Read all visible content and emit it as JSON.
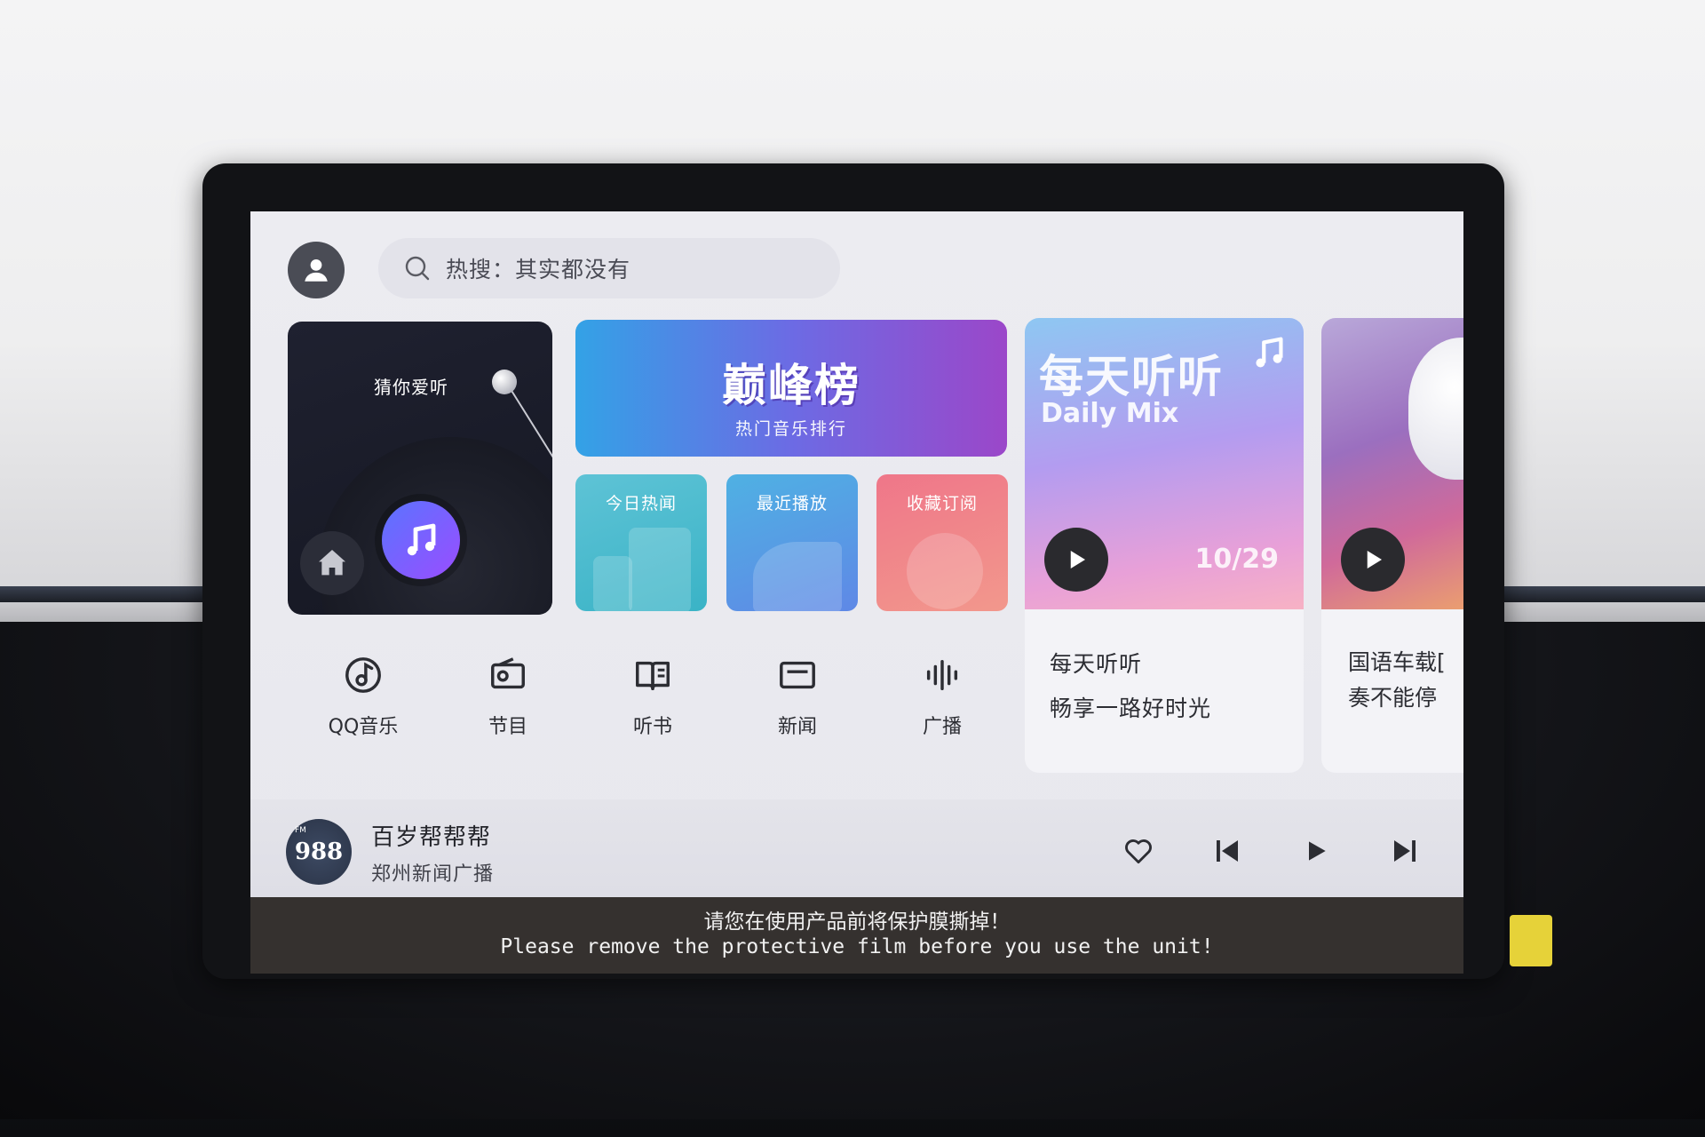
{
  "search": {
    "placeholder_text": "热搜：其实都没有"
  },
  "guess": {
    "title": "猜你爱听"
  },
  "peak": {
    "title": "巅峰榜",
    "subtitle": "热门音乐排行"
  },
  "tiles": [
    {
      "label": "今日热闻"
    },
    {
      "label": "最近播放"
    },
    {
      "label": "收藏订阅"
    }
  ],
  "daily_mix": {
    "title_cn": "每天听听",
    "title_en": "Daily Mix",
    "date": "10/29",
    "line1": "每天听听",
    "line2": "畅享一路好时光"
  },
  "car_playlist": {
    "line1": "国语车载[",
    "line2": "奏不能停"
  },
  "categories": [
    {
      "label": "QQ音乐",
      "icon": "qq-music-icon"
    },
    {
      "label": "节目",
      "icon": "radio-program-icon"
    },
    {
      "label": "听书",
      "icon": "audiobook-icon"
    },
    {
      "label": "新闻",
      "icon": "news-icon"
    },
    {
      "label": "广播",
      "icon": "broadcast-icon"
    }
  ],
  "player": {
    "station_logo": "988",
    "station_logo_small": "FM",
    "title": "百岁帮帮帮",
    "subtitle": "郑州新闻广播"
  },
  "notice": {
    "cn": "请您在使用产品前将保护膜撕掉！",
    "en": "Please remove the protective film before you use the unit!"
  }
}
